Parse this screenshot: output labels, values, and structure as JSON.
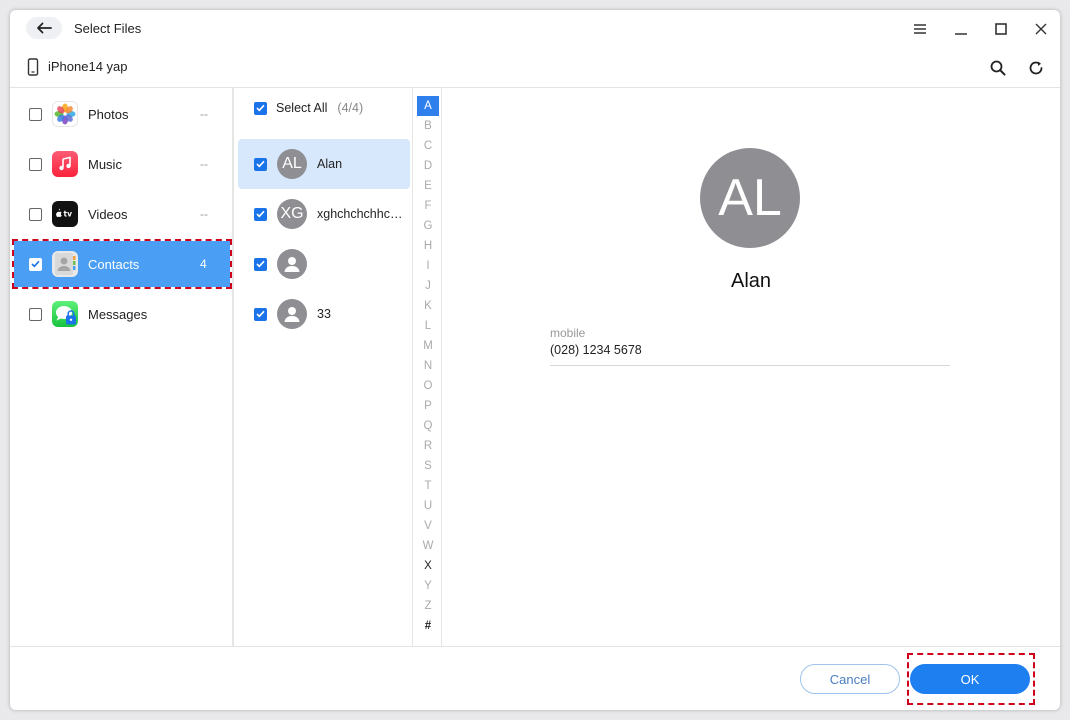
{
  "window": {
    "title": "Select Files"
  },
  "device": {
    "name": "iPhone14 yap"
  },
  "categories": [
    {
      "label": "Photos",
      "count": "--",
      "checked": false,
      "icon": "photos-icon"
    },
    {
      "label": "Music",
      "count": "--",
      "checked": false,
      "icon": "music-icon"
    },
    {
      "label": "Videos",
      "count": "--",
      "checked": false,
      "icon": "tv-icon"
    },
    {
      "label": "Contacts",
      "count": "4",
      "checked": true,
      "icon": "contacts-icon"
    },
    {
      "label": "Messages",
      "count": "",
      "checked": false,
      "icon": "messages-icon"
    }
  ],
  "contact_list": {
    "select_all_label": "Select All",
    "select_all_count": "(4/4)",
    "items": [
      {
        "initials": "AL",
        "name": "Alan",
        "checked": true
      },
      {
        "initials": "XG",
        "name": "xghchchchhchchc",
        "checked": true
      },
      {
        "initials": "",
        "name": "",
        "checked": true
      },
      {
        "initials": "",
        "name": "33",
        "checked": true
      }
    ]
  },
  "alphabet": [
    "A",
    "B",
    "C",
    "D",
    "E",
    "F",
    "G",
    "H",
    "I",
    "J",
    "K",
    "L",
    "M",
    "N",
    "O",
    "P",
    "Q",
    "R",
    "S",
    "T",
    "U",
    "V",
    "W",
    "X",
    "Y",
    "Z",
    "#"
  ],
  "detail": {
    "initials": "AL",
    "name": "Alan",
    "field_label": "mobile",
    "field_value": "(028) 1234 5678"
  },
  "footer": {
    "cancel_label": "Cancel",
    "ok_label": "OK"
  },
  "colors": {
    "accent": "#1e7ff0",
    "selected_row": "#4a9ff5",
    "highlight": "#d0021b"
  }
}
